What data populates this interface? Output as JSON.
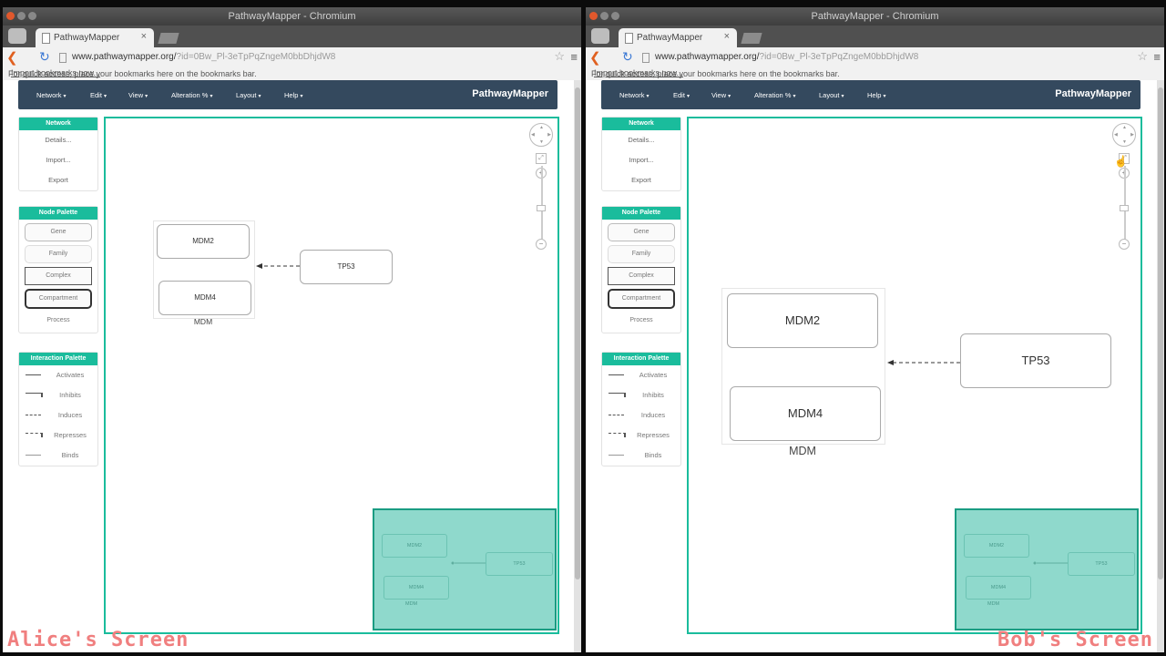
{
  "colors": {
    "accent": "#1abc9c",
    "navbar": "#34495e",
    "caption": "#f07f7f",
    "minimap": "#8fd9cc"
  },
  "browser": {
    "window_title": "PathwayMapper - Chromium",
    "tab_title": "PathwayMapper",
    "tab_close": "×",
    "url_host": "www.pathwaymapper.org/",
    "url_path": "?id=0Bw_Pl-3eTpPqZngeM0bbDhjdW8",
    "bookmark_text": "For quick access, place your bookmarks here on the bookmarks bar.",
    "bookmark_link": "Import bookmarks now..."
  },
  "app": {
    "brand": "PathwayMapper",
    "menus": [
      "Network",
      "Edit",
      "View",
      "Alteration %",
      "Layout",
      "Help"
    ],
    "network_panel": {
      "title": "Network",
      "items": [
        "Details...",
        "Import...",
        "Export"
      ]
    },
    "node_palette": {
      "title": "Node Palette",
      "items": [
        "Gene",
        "Family",
        "Complex",
        "Compartment",
        "Process"
      ]
    },
    "interaction_palette": {
      "title": "Interaction Palette",
      "items": [
        "Activates",
        "Inhibits",
        "Induces",
        "Represses",
        "Binds"
      ]
    },
    "zoom": {
      "plus": "+",
      "minus": "−",
      "fit": "⤢"
    }
  },
  "graph": {
    "nodes": {
      "mdm2": "MDM2",
      "mdm4": "MDM4",
      "tp53": "TP53"
    },
    "compartment_label": "MDM"
  },
  "captions": {
    "alice": "Alice's Screen",
    "bob": "Bob's Screen"
  }
}
